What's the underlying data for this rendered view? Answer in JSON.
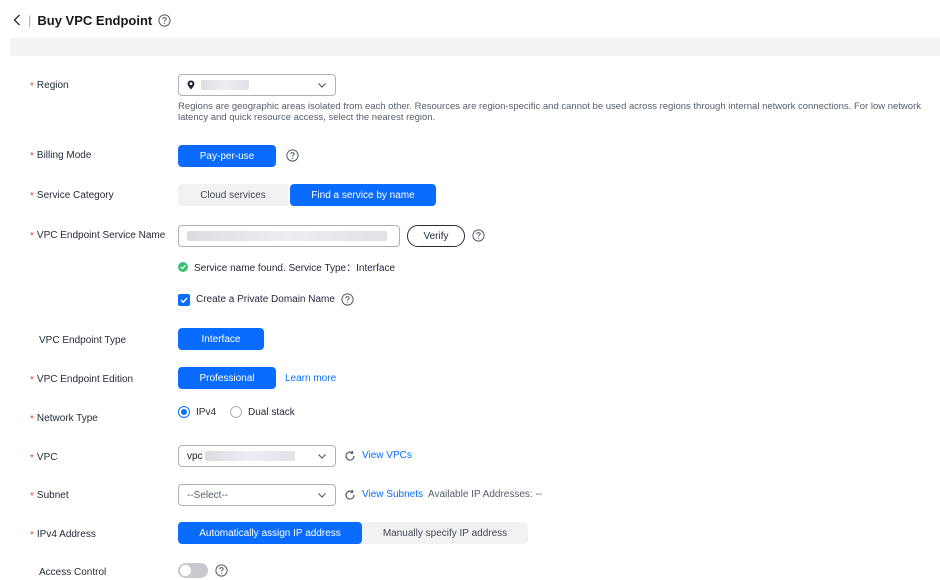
{
  "header": {
    "title": "Buy VPC Endpoint"
  },
  "region": {
    "label": "Region",
    "hint": "Regions are geographic areas isolated from each other. Resources are region-specific and cannot be used across regions through internal network connections. For low network latency and quick resource access, select the nearest region."
  },
  "billing": {
    "label": "Billing Mode",
    "button": "Pay-per-use"
  },
  "service_category": {
    "label": "Service Category",
    "options": [
      "Cloud services",
      "Find a service by name"
    ],
    "selected": "Find a service by name"
  },
  "service_name": {
    "label": "VPC Endpoint Service Name",
    "verify": "Verify",
    "status": "Service name found.  Service Type：Interface"
  },
  "private_domain": {
    "label": "Create a Private Domain Name",
    "checked": true
  },
  "endpoint_type": {
    "label": "VPC Endpoint Type",
    "button": "Interface"
  },
  "edition": {
    "label": "VPC Endpoint Edition",
    "button": "Professional",
    "link": "Learn more"
  },
  "network_type": {
    "label": "Network Type",
    "options": [
      "IPv4",
      "Dual stack"
    ],
    "selected": "IPv4"
  },
  "vpc": {
    "label": "VPC",
    "value_prefix": "vpc",
    "link": "View VPCs"
  },
  "subnet": {
    "label": "Subnet",
    "placeholder": "--Select--",
    "link": "View Subnets",
    "available": "Available IP Addresses: --"
  },
  "ipv4": {
    "label": "IPv4 Address",
    "options": [
      "Automatically assign IP address",
      "Manually specify IP address"
    ],
    "selected": "Automatically assign IP address"
  },
  "access_control": {
    "label": "Access Control",
    "enabled": false
  },
  "colors": {
    "primary": "#0a6cff",
    "required": "#e3472e",
    "success": "#3ac074"
  }
}
